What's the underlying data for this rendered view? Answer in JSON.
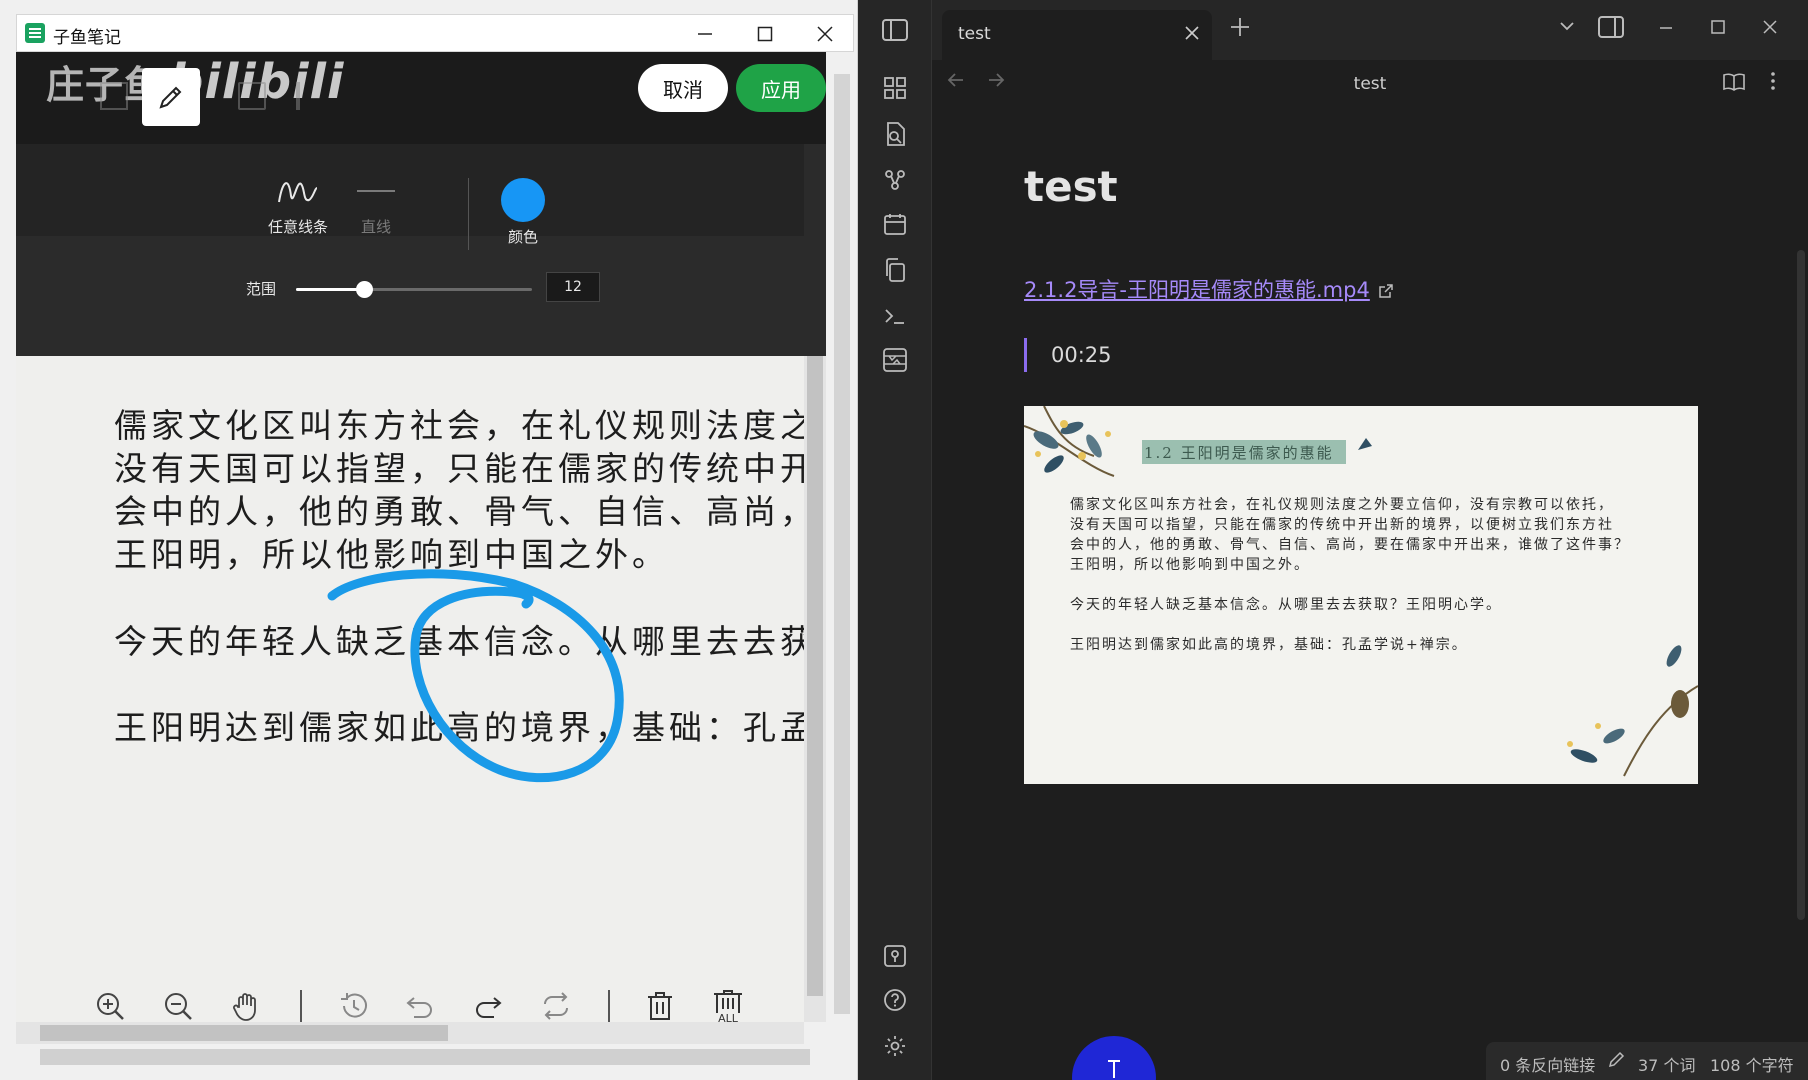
{
  "ziyu": {
    "title": "子鱼笔记",
    "watermark": "庄子鱼",
    "watermark_sub": "bilibili",
    "cancel_label": "取消",
    "apply_label": "应用",
    "brush_freeform": "任意线条",
    "brush_line": "直线",
    "color_label": "颜色",
    "range_label": "范围",
    "range_value": "12",
    "range_fraction": 0.29,
    "color": "#1796f5",
    "doc_lines": [
      "儒家文化区叫东方社会，在礼仪规则法度之外",
      "没有天国可以指望，只能在儒家的传统中开出",
      "会中的人，他的勇敢、骨气、自信、高尚，要",
      "王阳明，所以他影响到中国之外。",
      "今天的年轻人缺乏基本信念。从哪里去去获取",
      "王阳明达到儒家如此高的境界，基础：孔孟学"
    ],
    "toolbar_icons": [
      "zoom-in-icon",
      "zoom-out-icon",
      "hand-icon",
      "history-icon",
      "undo-icon",
      "redo-icon",
      "repeat-icon",
      "delete-icon",
      "delete-all-icon"
    ],
    "delete_all_text": "ALL"
  },
  "obsidian": {
    "tab_title": "test",
    "view_title": "test",
    "heading": "test",
    "link_text": "2.1.2导言-王阳明是儒家的惠能.mp4",
    "timestamp": "00:25",
    "slide": {
      "title": "1.2 王阳明是儒家的惠能",
      "lines": [
        "儒家文化区叫东方社会，在礼仪规则法度之外要立信仰，没有宗教可以依托，",
        "没有天国可以指望，只能在儒家的传统中开出新的境界，以便树立我们东方社",
        "会中的人，他的勇敢、骨气、自信、高尚，要在儒家中开出来，谁做了这件事？",
        "王阳明，所以他影响到中国之外。",
        "今天的年轻人缺乏基本信念。从哪里去去获取？王阳明心学。",
        "王阳明达到儒家如此高的境界，基础：孔孟学说+禅宗。"
      ]
    },
    "status": {
      "backlinks": "0 条反向链接",
      "words": "37 个词",
      "chars": "108 个字符"
    },
    "accent": "#a68af9"
  },
  "desktop_slice": {
    "char": "文",
    "badge": "T"
  }
}
